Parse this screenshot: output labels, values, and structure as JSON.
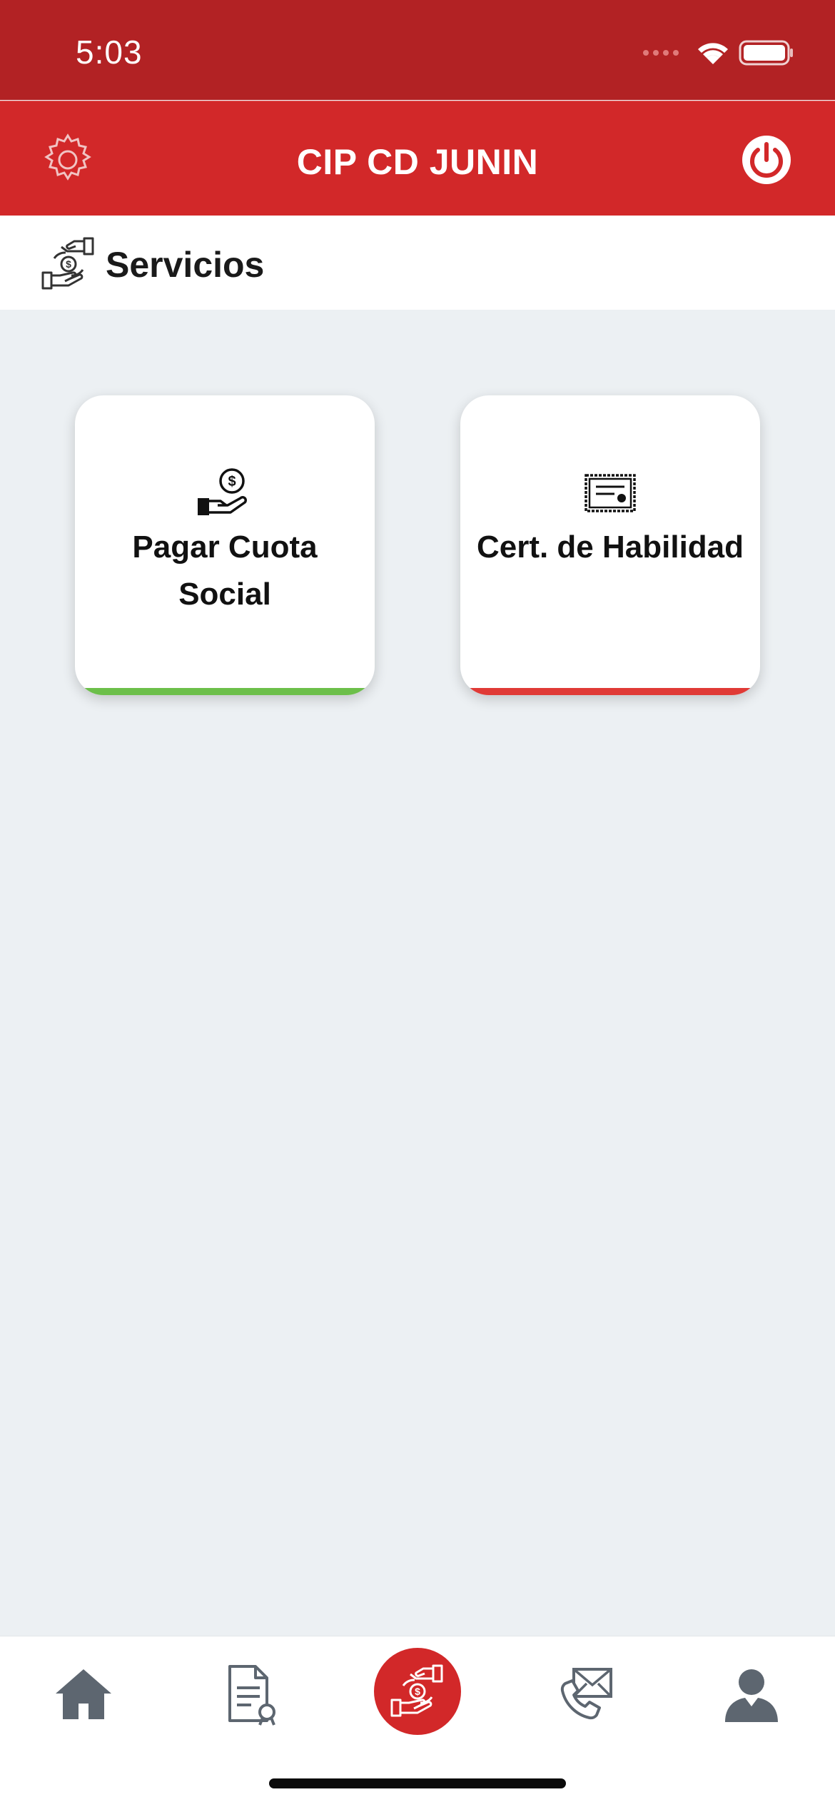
{
  "status_bar": {
    "time": "5:03"
  },
  "header": {
    "title": "CIP CD JUNIN"
  },
  "section": {
    "title": "Servicios"
  },
  "cards": [
    {
      "label": "Pagar Cuota Social",
      "accent_color": "#6cbf4a",
      "icon": "hand-coin-icon"
    },
    {
      "label": "Cert. de Habilidad",
      "accent_color": "#e03a36",
      "icon": "certificate-icon"
    }
  ],
  "tabbar": {
    "items": [
      {
        "icon": "home-icon"
      },
      {
        "icon": "document-certificate-icon"
      },
      {
        "icon": "services-exchange-icon",
        "active": true
      },
      {
        "icon": "phone-mail-icon"
      },
      {
        "icon": "user-icon"
      }
    ]
  },
  "colors": {
    "primary": "#d22829",
    "status_bar": "#b22224",
    "background": "#ecf0f3"
  }
}
